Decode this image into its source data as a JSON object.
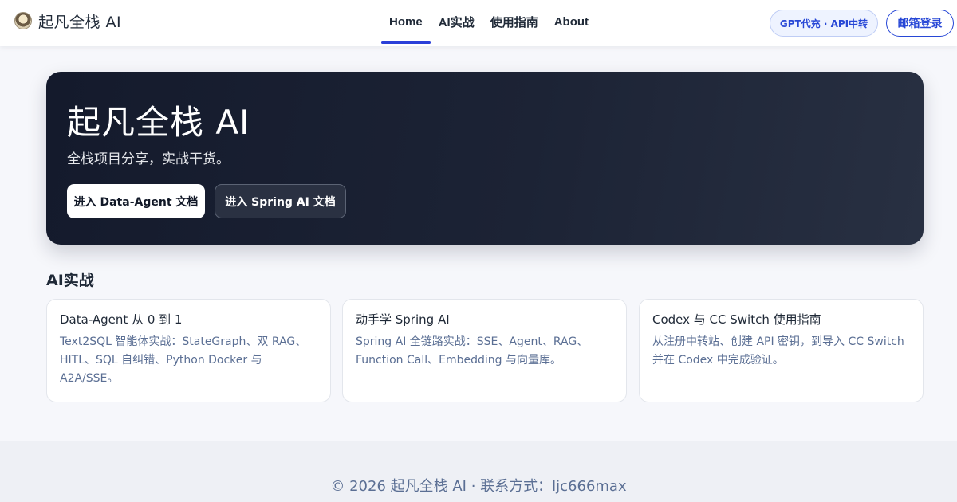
{
  "header": {
    "brand": "起凡全栈 AI",
    "logo_icon": "portrait-logo-icon",
    "nav": [
      {
        "label": "Home",
        "active": true
      },
      {
        "label": "AI实战",
        "active": false
      },
      {
        "label": "使用指南",
        "active": false
      },
      {
        "label": "About",
        "active": false
      }
    ],
    "gpt_button": "GPT代充 · API中转",
    "login_button": "邮箱登录"
  },
  "hero": {
    "title": "起凡全栈 AI",
    "subtitle": "全栈项目分享，实战干货。",
    "primary_button": "进入 Data-Agent 文档",
    "secondary_button": "进入 Spring AI 文档"
  },
  "section": {
    "title": "AI实战",
    "cards": [
      {
        "title": "Data-Agent 从 0 到 1",
        "desc": "Text2SQL 智能体实战：StateGraph、双 RAG、HITL、SQL 自纠错、Python Docker 与 A2A/SSE。"
      },
      {
        "title": "动手学 Spring AI",
        "desc": "Spring AI 全链路实战：SSE、Agent、RAG、Function Call、Embedding 与向量库。"
      },
      {
        "title": "Codex 与 CC Switch 使用指南",
        "desc": "从注册中转站、创建 API 密钥，到导入 CC Switch 并在 Codex 中完成验证。"
      }
    ]
  },
  "footer": {
    "text": "© 2026 起凡全栈 AI · 联系方式：ljc666max"
  },
  "colors": {
    "accent": "#2a3fd8",
    "hero_bg": "#1c2335",
    "card_desc": "#5b6f94",
    "page_bg": "#f6f7fb"
  }
}
